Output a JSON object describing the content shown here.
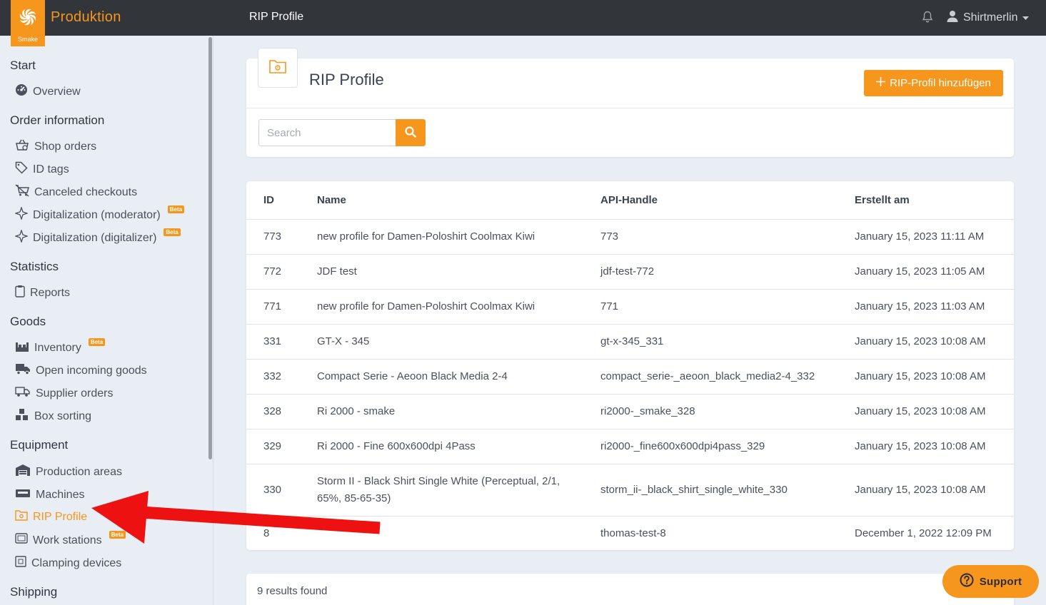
{
  "app": {
    "brand": "Produktion",
    "logo_text": "Smake",
    "page_title": "RIP Profile"
  },
  "topbar": {
    "title": "RIP Profile",
    "user": "Shirtmerlin",
    "icons": [
      "bell-icon",
      "user-icon",
      "caret-down-icon"
    ]
  },
  "sidebar": {
    "sections": [
      {
        "title": "Start",
        "items": [
          {
            "label": "Overview",
            "icon": "dashboard-icon"
          }
        ]
      },
      {
        "title": "Order information",
        "items": [
          {
            "label": "Shop orders",
            "icon": "basket-icon"
          },
          {
            "label": "ID tags",
            "icon": "tag-icon"
          },
          {
            "label": "Canceled checkouts",
            "icon": "cart-x-icon"
          },
          {
            "label": "Digitalization (moderator)",
            "icon": "sparkle-icon",
            "badge": "Beta"
          },
          {
            "label": "Digitalization (digitalizer)",
            "icon": "sparkle-icon",
            "badge": "Beta"
          }
        ]
      },
      {
        "title": "Statistics",
        "items": [
          {
            "label": "Reports",
            "icon": "clipboard-icon"
          }
        ]
      },
      {
        "title": "Goods",
        "items": [
          {
            "label": "Inventory",
            "icon": "warehouse-icon",
            "badge": "Beta"
          },
          {
            "label": "Open incoming goods",
            "icon": "truck-icon"
          },
          {
            "label": "Supplier orders",
            "icon": "supplier-icon"
          },
          {
            "label": "Box sorting",
            "icon": "boxes-icon"
          }
        ]
      },
      {
        "title": "Equipment",
        "items": [
          {
            "label": "Production areas",
            "icon": "building-icon"
          },
          {
            "label": "Machines",
            "icon": "machine-icon"
          },
          {
            "label": "RIP Profile",
            "icon": "folder-gear-icon",
            "active": true
          },
          {
            "label": "Work stations",
            "icon": "monitor-icon",
            "badge": "Beta"
          },
          {
            "label": "Clamping devices",
            "icon": "clamp-icon"
          }
        ]
      },
      {
        "title": "Shipping",
        "items": []
      }
    ]
  },
  "header": {
    "title": "RIP Profile",
    "add_button": "RIP-Profil hinzufügen",
    "search_placeholder": "Search"
  },
  "table": {
    "columns": [
      "ID",
      "Name",
      "API-Handle",
      "Erstellt am"
    ],
    "rows": [
      [
        "773",
        "new profile for Damen-Poloshirt Coolmax Kiwi",
        "773",
        "January 15, 2023 11:11 AM"
      ],
      [
        "772",
        "JDF test",
        "jdf-test-772",
        "January 15, 2023 11:05 AM"
      ],
      [
        "771",
        "new profile for Damen-Poloshirt Coolmax Kiwi",
        "771",
        "January 15, 2023 11:03 AM"
      ],
      [
        "331",
        "GT-X - 345",
        "gt-x-345_331",
        "January 15, 2023 10:08 AM"
      ],
      [
        "332",
        "Compact Serie - Aeoon Black Media 2-4",
        "compact_serie-_aeoon_black_media2-4_332",
        "January 15, 2023 10:08 AM"
      ],
      [
        "328",
        "Ri 2000 - smake",
        "ri2000-_smake_328",
        "January 15, 2023 10:08 AM"
      ],
      [
        "329",
        "Ri 2000 - Fine 600x600dpi 4Pass",
        "ri2000-_fine600x600dpi4pass_329",
        "January 15, 2023 10:08 AM"
      ],
      [
        "330",
        "Storm II - Black Shirt Single White (Perceptual, 2/1, 65%, 85-65-35)",
        "storm_ii-_black_shirt_single_white_330",
        "January 15, 2023 10:08 AM"
      ],
      [
        "8",
        "",
        "thomas-test-8",
        "December 1, 2022 12:09 PM"
      ]
    ]
  },
  "footer": {
    "results": "9 results found"
  },
  "support": {
    "label": "Support"
  },
  "colors": {
    "accent": "#f7961c",
    "topbar": "#32353a",
    "background": "#e9eef4",
    "annotation_arrow": "#ee1111"
  }
}
